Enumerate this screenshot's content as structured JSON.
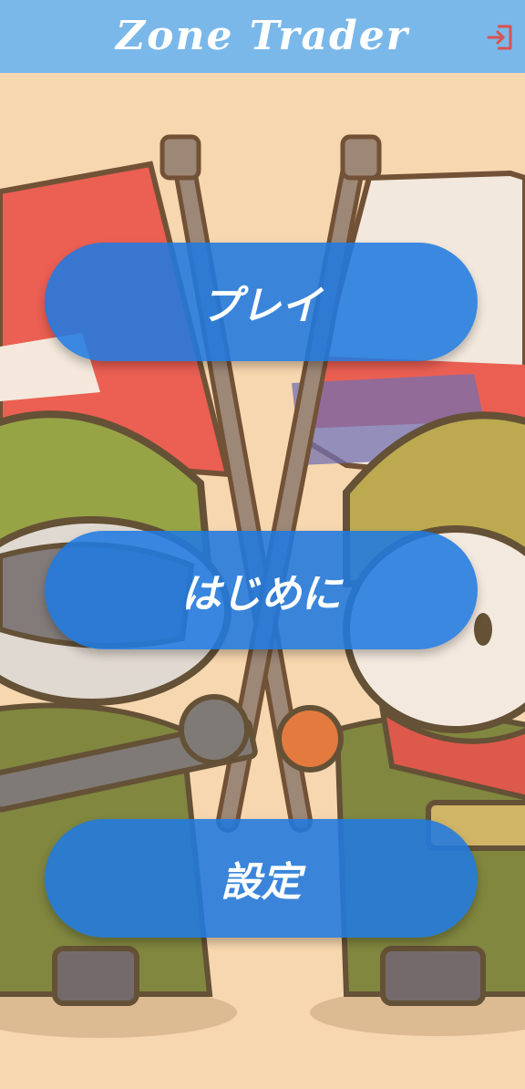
{
  "header": {
    "title": "Zone Trader",
    "logout_icon": "logout-icon",
    "background_color": "#7ab8ea",
    "icon_color": "#d9534f"
  },
  "menu": {
    "play_label": "プレイ",
    "intro_label": "はじめに",
    "settings_label": "設定",
    "button_color": "#2a7fdc"
  },
  "background": {
    "color": "#f7d7b0"
  }
}
